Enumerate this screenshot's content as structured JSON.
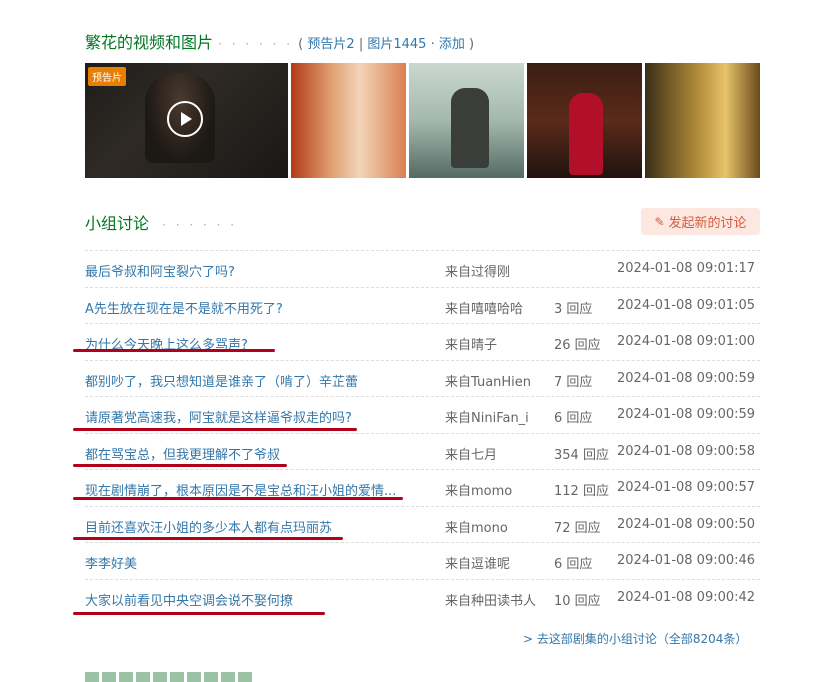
{
  "media": {
    "title": "繁花的视频和图片",
    "dots": "· · · · · ·",
    "open_paren": "(",
    "trailer_link": "预告片2",
    "sep": "|",
    "photos_link": "图片1445",
    "dot_sep": "·",
    "add_link": "添加",
    "close_paren": ")",
    "badge": "预告片"
  },
  "discussion": {
    "title": "小组讨论",
    "dots": "· · · · · ·",
    "new_button": "发起新的讨论",
    "rows": [
      {
        "title": "最后爷叔和阿宝裂穴了吗?",
        "from": "来自过得刚",
        "replies": "",
        "time": "2024-01-08 09:01:17"
      },
      {
        "title": "A先生放在现在是不是就不用死了?",
        "from": "来自嘻嘻哈哈",
        "replies": "3 回应",
        "time": "2024-01-08 09:01:05"
      },
      {
        "title": "为什么今天晚上这么多骂声?",
        "from": "来自晴子",
        "replies": "26 回应",
        "time": "2024-01-08 09:01:00"
      },
      {
        "title": "都别吵了，我只想知道是谁亲了（啃了）辛芷蕾",
        "from": "来自TuanHien",
        "replies": "7 回应",
        "time": "2024-01-08 09:00:59"
      },
      {
        "title": "请原著党高速我，阿宝就是这样逼爷叔走的吗?",
        "from": "来自NiniFan_i",
        "replies": "6 回应",
        "time": "2024-01-08 09:00:59"
      },
      {
        "title": "都在骂宝总，但我更理解不了爷叔",
        "from": "来自七月",
        "replies": "354 回应",
        "time": "2024-01-08 09:00:58"
      },
      {
        "title": "现在剧情崩了，根本原因是不是宝总和汪小姐的爱情...",
        "from": "来自momo",
        "replies": "112 回应",
        "time": "2024-01-08 09:00:57"
      },
      {
        "title": "目前还喜欢汪小姐的多少本人都有点玛丽苏",
        "from": "来自mono",
        "replies": "72 回应",
        "time": "2024-01-08 09:00:50"
      },
      {
        "title": "李李好美",
        "from": "来自逗谁呢",
        "replies": "6 回应",
        "time": "2024-01-08 09:00:46"
      },
      {
        "title": "大家以前看见中央空调会说不娶何撩",
        "from": "来自种田读书人",
        "replies": "10 回应",
        "time": "2024-01-08 09:00:42"
      }
    ],
    "more_link": "> 去这部剧集的小组讨论（全部8204条）"
  }
}
